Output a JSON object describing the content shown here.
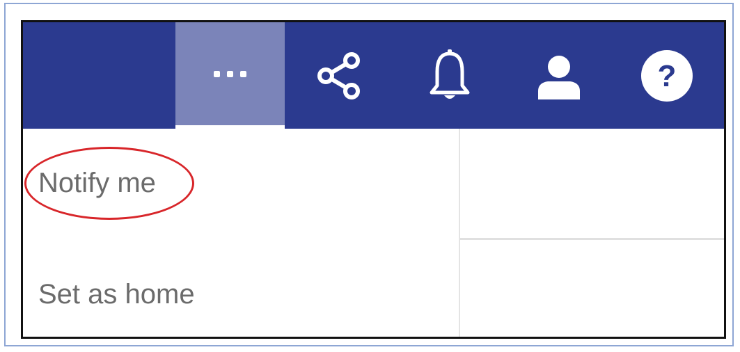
{
  "toolbar": {
    "background_color": "#2b3a8f",
    "active_color": "#7b84b9",
    "buttons": [
      {
        "icon": "more-horizontal-icon",
        "active": true
      },
      {
        "icon": "share-icon"
      },
      {
        "icon": "bell-icon"
      },
      {
        "icon": "user-icon"
      },
      {
        "icon": "help-icon",
        "glyph": "?"
      }
    ]
  },
  "menu": {
    "items": [
      {
        "label": "Notify me",
        "highlighted": true
      },
      {
        "label": "Set as home"
      }
    ],
    "highlight_color": "#d8262a"
  }
}
